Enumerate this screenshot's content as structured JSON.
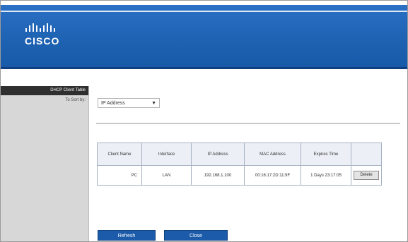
{
  "brand": {
    "logo_text": "CISCO"
  },
  "sidebar": {
    "heading": "DHCP Client Table",
    "sub_label": "To Sort by:"
  },
  "filter": {
    "selected": "IP Address"
  },
  "table": {
    "columns": [
      "Client Name",
      "Interface",
      "IP Address",
      "MAC Address",
      "Expires Time",
      ""
    ],
    "rows": [
      {
        "client_name": "PC",
        "interface": "LAN",
        "ip_address": "192.168.1.100",
        "mac_address": "00:16:17:2D:11:9F",
        "expires_time": "1 Days 23:17:05",
        "action": "Delete"
      }
    ]
  },
  "buttons": {
    "refresh": "Refresh",
    "close": "Close"
  }
}
